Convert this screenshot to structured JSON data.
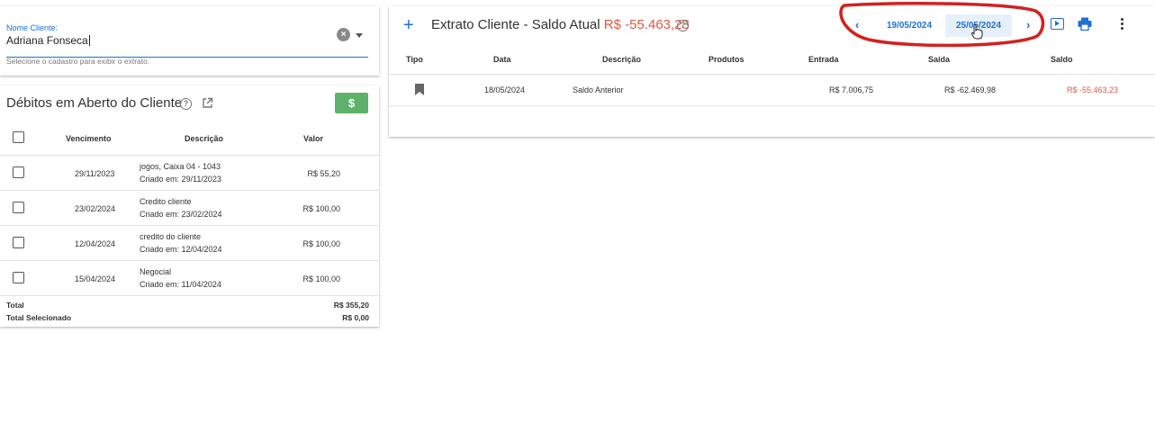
{
  "client_search": {
    "label": "Nome Cliente:",
    "value": "Adriana Fonseca",
    "hint": "Selecione o cadastro para exibir o extrato."
  },
  "debits": {
    "title": "Débitos em Aberto do Cliente",
    "money_button": "$",
    "columns": {
      "due": "Vencimento",
      "description": "Descrição",
      "value": "Valor"
    },
    "rows": [
      {
        "due": "29/11/2023",
        "desc": "jogos, Caixa 04 - 1043",
        "created": "Criado em: 29/11/2023",
        "value": "R$ 55,20"
      },
      {
        "due": "23/02/2024",
        "desc": "Credito cliente",
        "created": "Criado em: 23/02/2024",
        "value": "R$ 100,00"
      },
      {
        "due": "12/04/2024",
        "desc": "credito do cliente",
        "created": "Criado em: 12/04/2024",
        "value": "R$ 100,00"
      },
      {
        "due": "15/04/2024",
        "desc": "Negocial",
        "created": "Criado em: 11/04/2024",
        "value": "R$ 100,00"
      }
    ],
    "total_label": "Total",
    "total_value": "R$ 355,20",
    "selected_label": "Total Selecionado",
    "selected_value": "R$ 0,00"
  },
  "statement": {
    "title": "Extrato Cliente - Saldo Atual",
    "balance": "R$ -55.463,23",
    "date_start": "19/05/2024",
    "date_end": "25/05/2024",
    "prev_arrow": "‹",
    "next_arrow": "›",
    "columns": {
      "type": "Tipo",
      "date": "Data",
      "description": "Descrição",
      "products": "Produtos",
      "in": "Entrada",
      "out": "Saída",
      "balance": "Saldo"
    },
    "rows": [
      {
        "date": "18/05/2024",
        "description": "Saldo Anterior",
        "products": "",
        "in": "R$ 7.006,75",
        "out": "R$ -62.469,98",
        "balance": "R$ -55.463,23"
      }
    ]
  },
  "colors": {
    "primary": "#1e6fd9",
    "negative": "#e0573f",
    "success": "#5cb26a",
    "annotation": "#d42020"
  }
}
